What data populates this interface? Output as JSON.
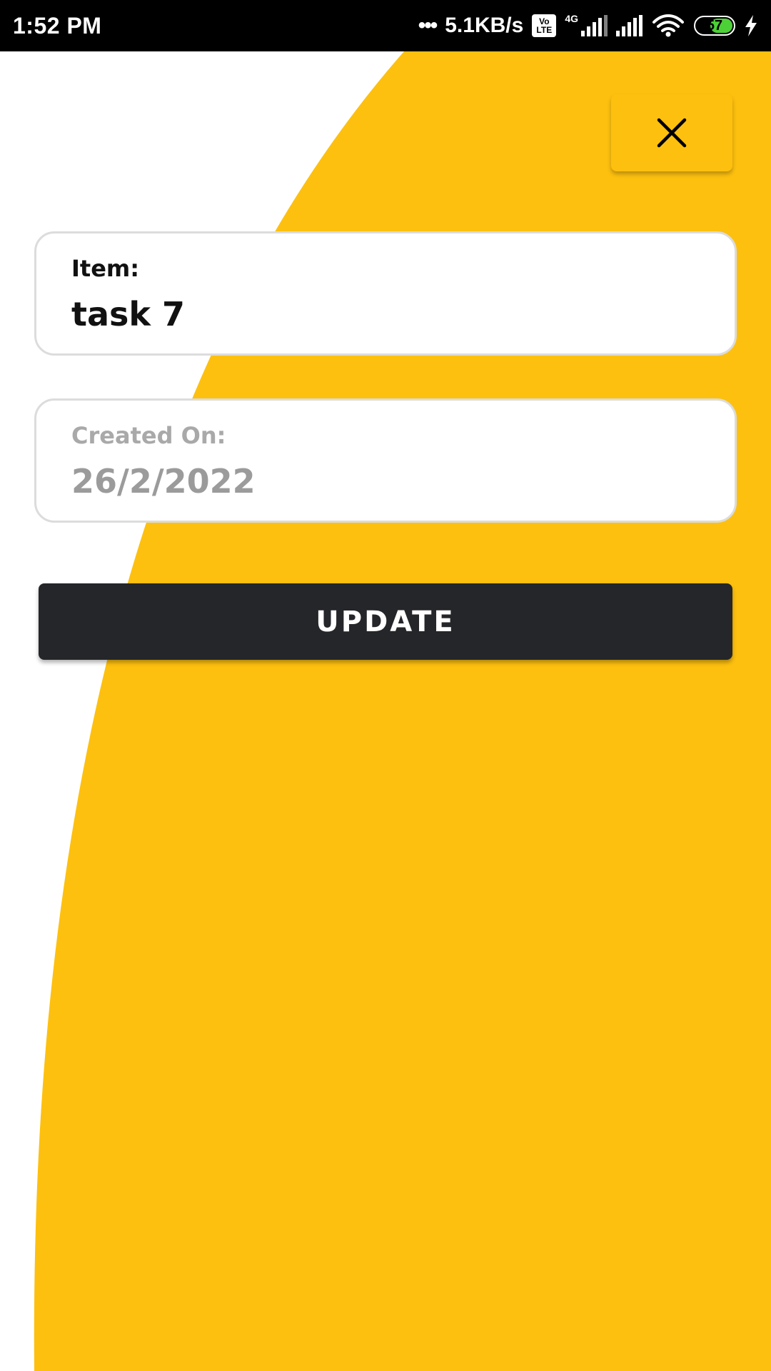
{
  "status_bar": {
    "time": "1:52 PM",
    "dots": "•••",
    "net_speed": "5.1KB/s",
    "volte_top": "Vo",
    "volte_bottom": "LTE",
    "network_type": "4G",
    "battery_level": "57",
    "icons": [
      "volte-icon",
      "signal-icon",
      "signal-icon",
      "wifi-icon",
      "battery-icon",
      "charging-icon"
    ]
  },
  "close_button": {
    "icon": "close-icon"
  },
  "item_field": {
    "label": "Item:",
    "value": "task 7"
  },
  "created_field": {
    "label": "Created On:",
    "value": "26/2/2022"
  },
  "update_button": {
    "label": "UPDATE"
  },
  "colors": {
    "accent": "#fdc00f",
    "button_dark": "#25262a",
    "background": "#ffffff",
    "status_bar": "#000000",
    "battery_fill": "#4cd137"
  }
}
